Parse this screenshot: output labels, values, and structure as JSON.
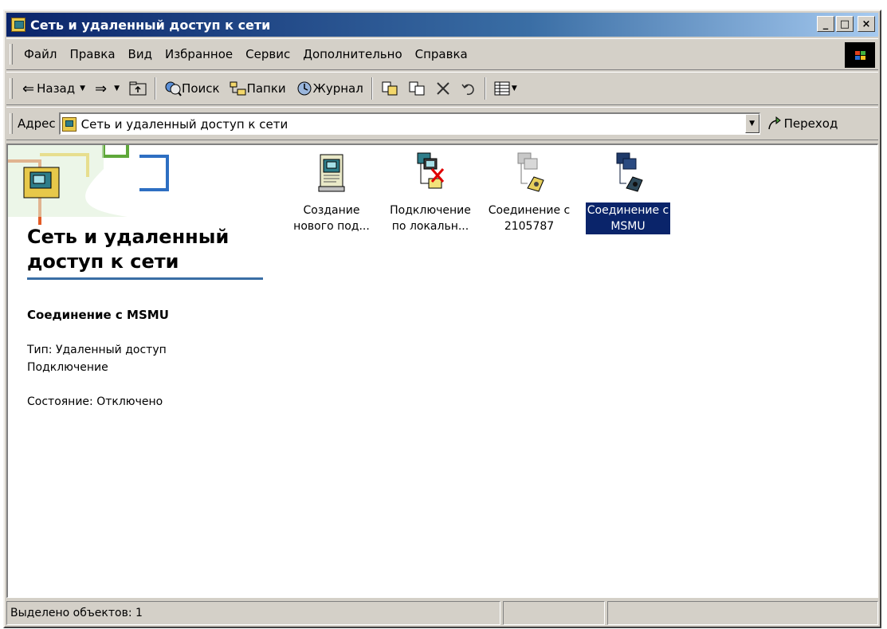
{
  "window": {
    "title": "Сеть и удаленный доступ к сети",
    "controls": {
      "minimize": "_",
      "maximize": "□",
      "close": "×"
    }
  },
  "menu": {
    "items": [
      {
        "label": "Файл",
        "accel": "Ф"
      },
      {
        "label": "Правка",
        "accel": "П"
      },
      {
        "label": "Вид",
        "accel": "В"
      },
      {
        "label": "Избранное",
        "accel": "И"
      },
      {
        "label": "Сервис",
        "accel": "е"
      },
      {
        "label": "Дополнительно",
        "accel": "Д"
      },
      {
        "label": "Справка",
        "accel": "С"
      }
    ]
  },
  "toolbar": {
    "back_label": "Назад",
    "search_label": "Поиск",
    "folders_label": "Папки",
    "history_label": "Журнал"
  },
  "address": {
    "label": "Адрес",
    "value": "Сеть и удаленный доступ к сети",
    "go_label": "Переход"
  },
  "left_pane": {
    "title": "Сеть и удаленный доступ к сети",
    "selected_name": "Соединение с MSMU",
    "type_text": "Тип: Удаленный доступ\nПодключение",
    "state_text": "Состояние: Отключено"
  },
  "items": [
    {
      "label": "Создание\nнового под...",
      "icon": "new-connection-wizard-icon"
    },
    {
      "label": "Подключение\nпо локальн...",
      "icon": "lan-connection-disconnected-icon"
    },
    {
      "label": "Соединение с\n2105787",
      "icon": "dialup-connection-icon"
    },
    {
      "label": "Соединение с\nMSMU",
      "icon": "dialup-connection-icon",
      "selected": true
    }
  ],
  "status": {
    "selected_text": "Выделено объектов: 1"
  },
  "colors": {
    "title_bar": "#0a246a",
    "selection": "#0a246a",
    "face": "#d4d0c8"
  }
}
